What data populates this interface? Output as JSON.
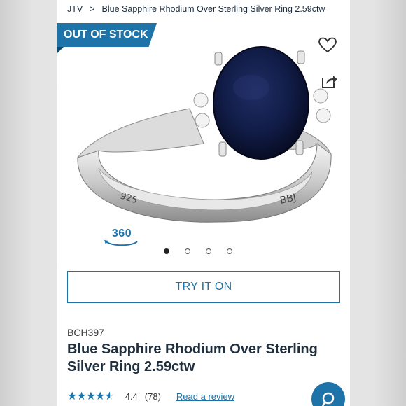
{
  "breadcrumb": {
    "root": "JTV",
    "separator": ">",
    "current": "Blue Sapphire Rhodium Over Sterling Silver Ring 2.59ctw"
  },
  "badge": {
    "label": "OUT OF STOCK"
  },
  "icons": {
    "wishlist": "heart-outline-icon",
    "share": "share-arrow-icon",
    "chat": "chat-search-icon"
  },
  "product_image": {
    "engraving_left": "925",
    "engraving_right": "BBJ"
  },
  "view360": {
    "label": "360"
  },
  "carousel": {
    "count": 4,
    "active_index": 0
  },
  "try_on": {
    "label": "TRY IT ON"
  },
  "product": {
    "sku": "BCH397",
    "title": "Blue Sapphire Rhodium Over Sterling Silver Ring 2.59ctw",
    "rating": {
      "value": "4.4",
      "count": "(78)",
      "stars_fraction": 0.88
    },
    "review_link": "Read a review"
  },
  "colors": {
    "accent": "#1e73a8",
    "badge_bg": "#1e73a8",
    "sapphire": "#101a3c"
  }
}
